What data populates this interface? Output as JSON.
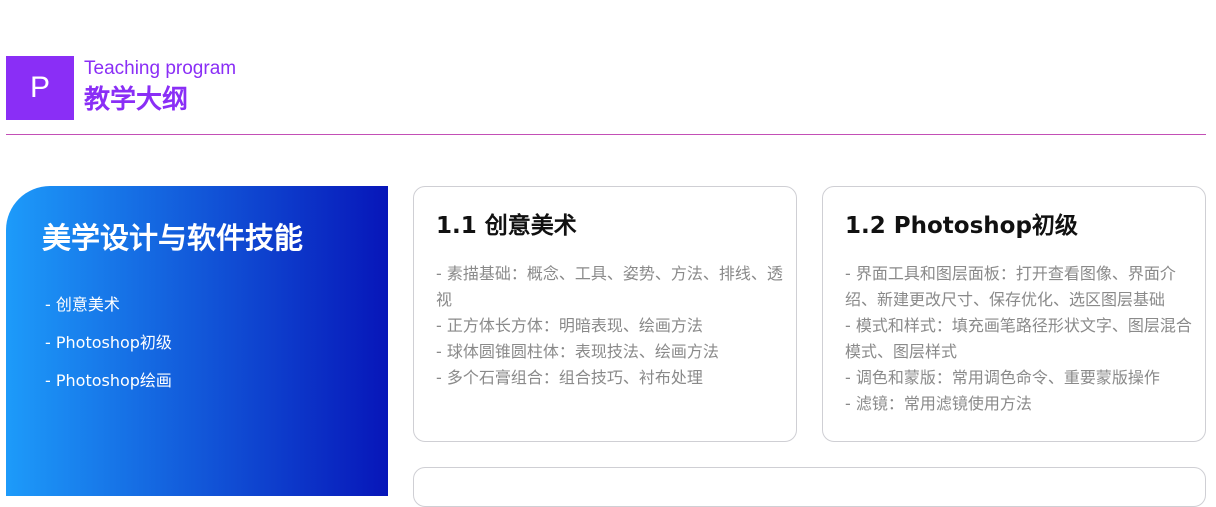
{
  "header": {
    "logo_letter": "P",
    "subtitle": "Teaching program",
    "title": "教学大纲"
  },
  "feature": {
    "title": "美学设计与软件技能",
    "items": [
      "- 创意美术",
      "- Photoshop初级",
      "- Photoshop绘画"
    ]
  },
  "cards": [
    {
      "title": "1.1 创意美术",
      "lines": [
        "- 素描基础：概念、工具、姿势、方法、排线、透视",
        "- 正方体长方体：明暗表现、绘画方法",
        "- 球体圆锥圆柱体：表现技法、绘画方法",
        "- 多个石膏组合：组合技巧、衬布处理"
      ]
    },
    {
      "title": "1.2 Photoshop初级",
      "lines": [
        "- 界面工具和图层面板：打开查看图像、界面介绍、新建更改尺寸、保存优化、选区图层基础",
        "- 模式和样式：填充画笔路径形状文字、图层混合模式、图层样式",
        "- 调色和蒙版：常用调色命令、重要蒙版操作",
        "- 滤镜：常用滤镜使用方法"
      ]
    }
  ],
  "colors": {
    "accent": "#8a2ef6",
    "divider": "#c34fb6",
    "gradient_start": "#1d9bfa",
    "gradient_end": "#0716b9"
  }
}
